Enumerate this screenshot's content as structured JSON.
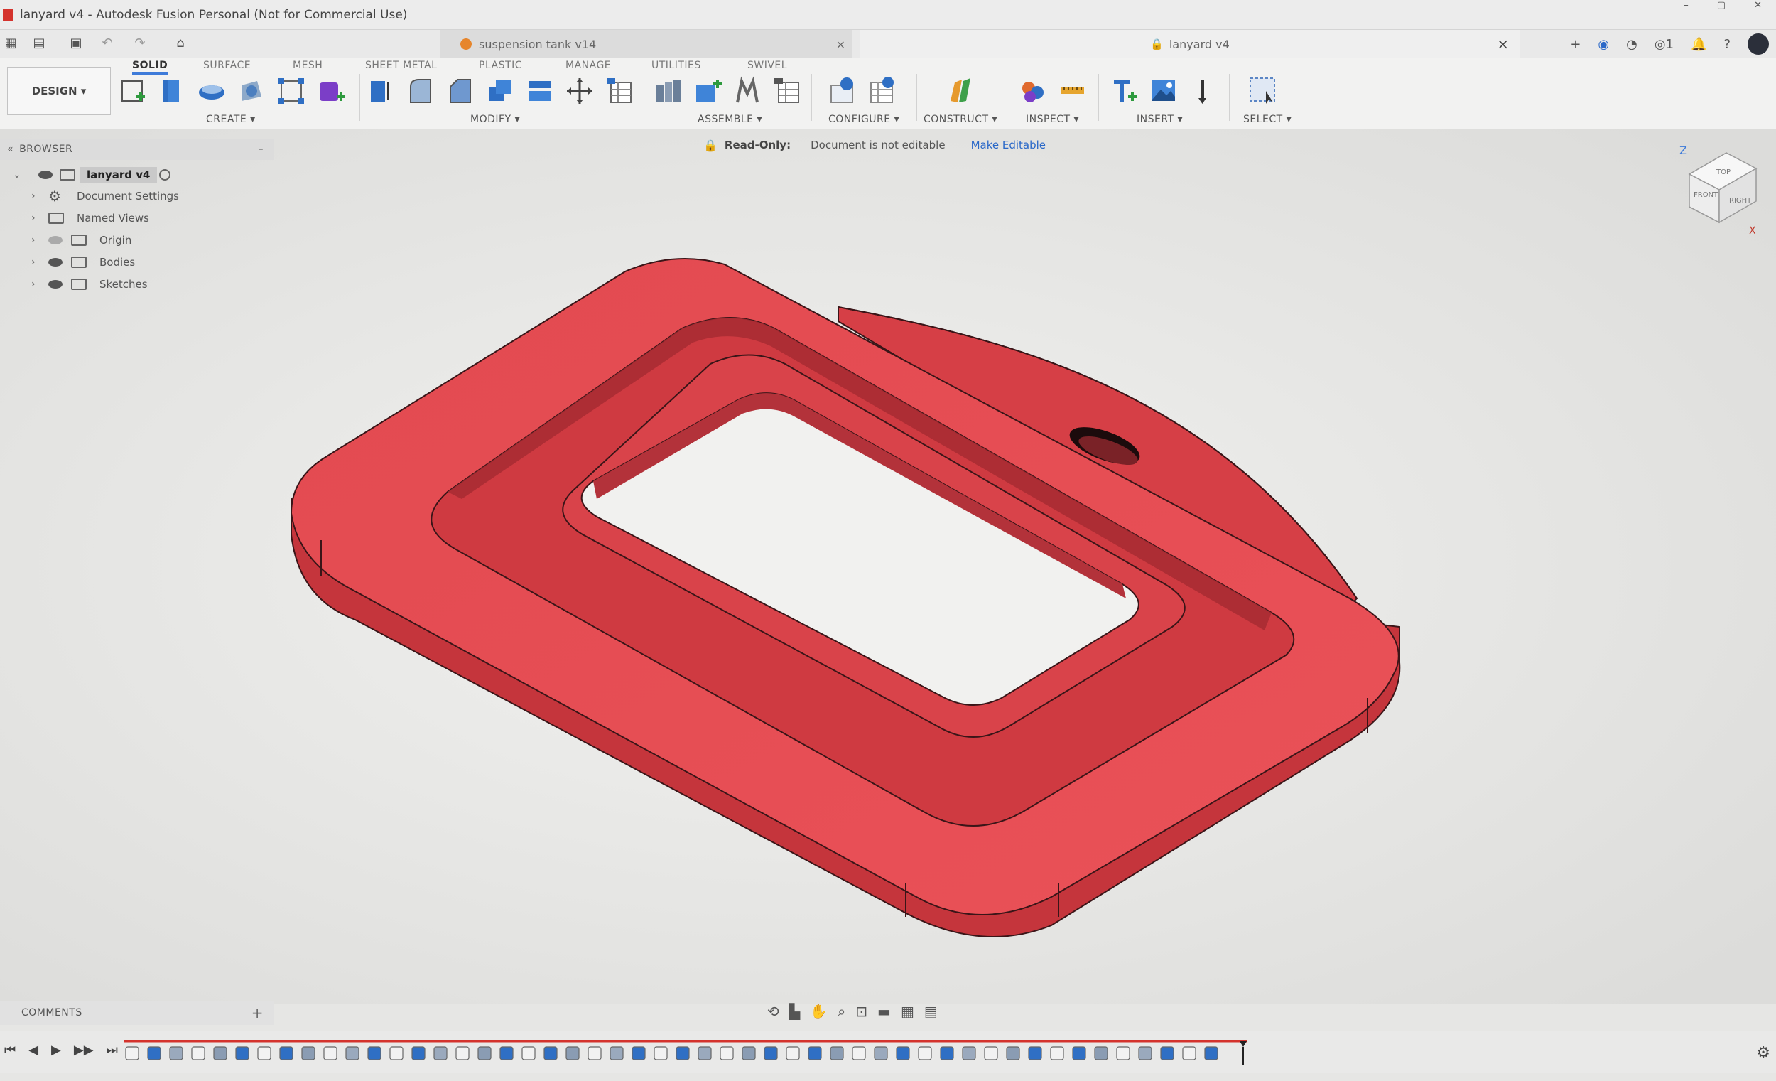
{
  "window": {
    "title": "lanyard v4 - Autodesk Fusion Personal (Not for Commercial Use)"
  },
  "tabs": {
    "inactive": {
      "label": "suspension tank v14",
      "close": "×"
    },
    "active": {
      "label": "lanyard v4",
      "close": "×"
    },
    "right": {
      "add": "+",
      "notifications": "1"
    }
  },
  "toolbar": {
    "workspace_button": "DESIGN ▾",
    "workspace_tabs": [
      "SOLID",
      "SURFACE",
      "MESH",
      "SHEET METAL",
      "PLASTIC",
      "MANAGE",
      "UTILITIES",
      "SWIVEL"
    ],
    "groups": {
      "create": "CREATE ▾",
      "modify": "MODIFY ▾",
      "assemble": "ASSEMBLE ▾",
      "configure": "CONFIGURE ▾",
      "construct": "CONSTRUCT ▾",
      "inspect": "INSPECT ▾",
      "insert": "INSERT ▾",
      "select": "SELECT ▾"
    },
    "accent_color": "#3e7bd9"
  },
  "browser": {
    "header": "BROWSER",
    "collapse": "–",
    "root": "lanyard v4",
    "items": [
      "Document Settings",
      "Named Views",
      "Origin",
      "Bodies",
      "Sketches"
    ]
  },
  "banner": {
    "label": "Read-Only:",
    "message": "Document is not editable",
    "link": "Make Editable"
  },
  "viewcube": {
    "faces": [
      "TOP",
      "FRONT",
      "RIGHT"
    ],
    "axes": [
      "Z",
      "X"
    ]
  },
  "comments": {
    "label": "COMMENTS",
    "add": "+"
  },
  "model": {
    "body_color": "#e2454c",
    "edge_color": "#3a1518"
  }
}
